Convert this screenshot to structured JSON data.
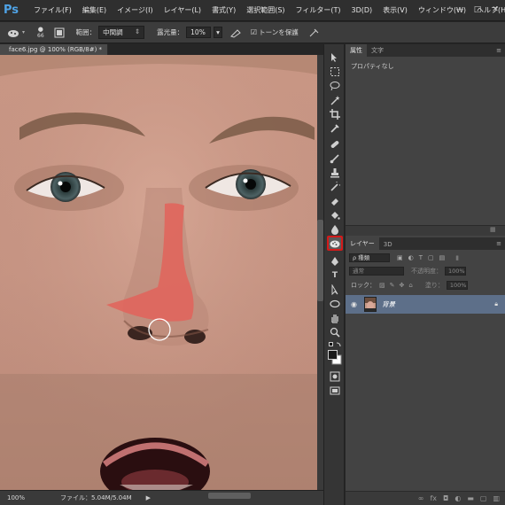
{
  "app": {
    "logo": "Ps",
    "menu": [
      "ファイル(F)",
      "編集(E)",
      "イメージ(I)",
      "レイヤー(L)",
      "書式(Y)",
      "選択範囲(S)",
      "フィルター(T)",
      "3D(D)",
      "表示(V)",
      "ウィンドウ(W)",
      "ヘルプ(H)"
    ],
    "window_controls": [
      "—",
      "□",
      "✕"
    ]
  },
  "options": {
    "brush_size": "66",
    "range_label": "範囲：",
    "range_value": "中間調",
    "exposure_label": "露光量：",
    "exposure_value": "10%",
    "protect_tones": "トーンを保護"
  },
  "document": {
    "tab_title": "face6.jpg @ 100% (RGB/8#) *"
  },
  "status": {
    "zoom": "100%",
    "file_info": "ファイル：5.04M/5.04M"
  },
  "properties": {
    "tabs": [
      "属性",
      "文字"
    ],
    "content": "プロパティなし"
  },
  "layers": {
    "tabs": [
      "レイヤー",
      "3D"
    ],
    "kind": "ρ 種類",
    "blend_mode": "通常",
    "opacity_label": "不透明度：",
    "opacity_value": "100%",
    "lock_label": "ロック：",
    "fill_label": "塗り：",
    "fill_value": "100%",
    "layer_name": "背景"
  },
  "colors": {
    "accent": "#d31a1a",
    "brand": "#4fa3e6",
    "selected_layer": "#5d6f89"
  }
}
